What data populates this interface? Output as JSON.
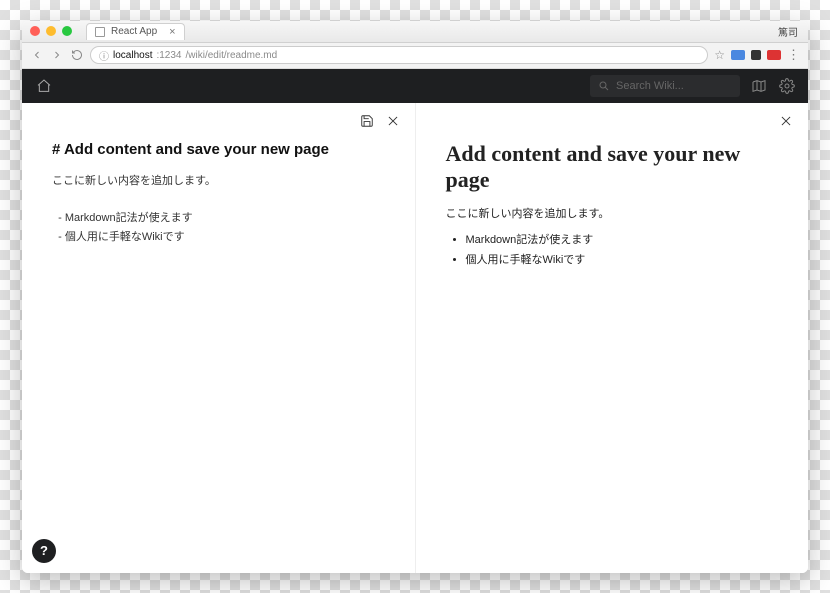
{
  "browser": {
    "tab_title": "React App",
    "profile_name": "篤司",
    "url_host": "localhost",
    "url_port": ":1234",
    "url_path": "/wiki/edit/readme.md"
  },
  "header": {
    "search_placeholder": "Search Wiki..."
  },
  "editor": {
    "title_raw": "# Add content and save your new page",
    "body_raw": "ここに新しい内容を追加します。\n\n  - Markdown記法が使えます\n  - 個人用に手軽なWikiです"
  },
  "preview": {
    "title": "Add content and save your new page",
    "paragraph": "ここに新しい内容を追加します。",
    "list": [
      "Markdown記法が使えます",
      "個人用に手軽なWikiです"
    ]
  },
  "help_label": "?"
}
